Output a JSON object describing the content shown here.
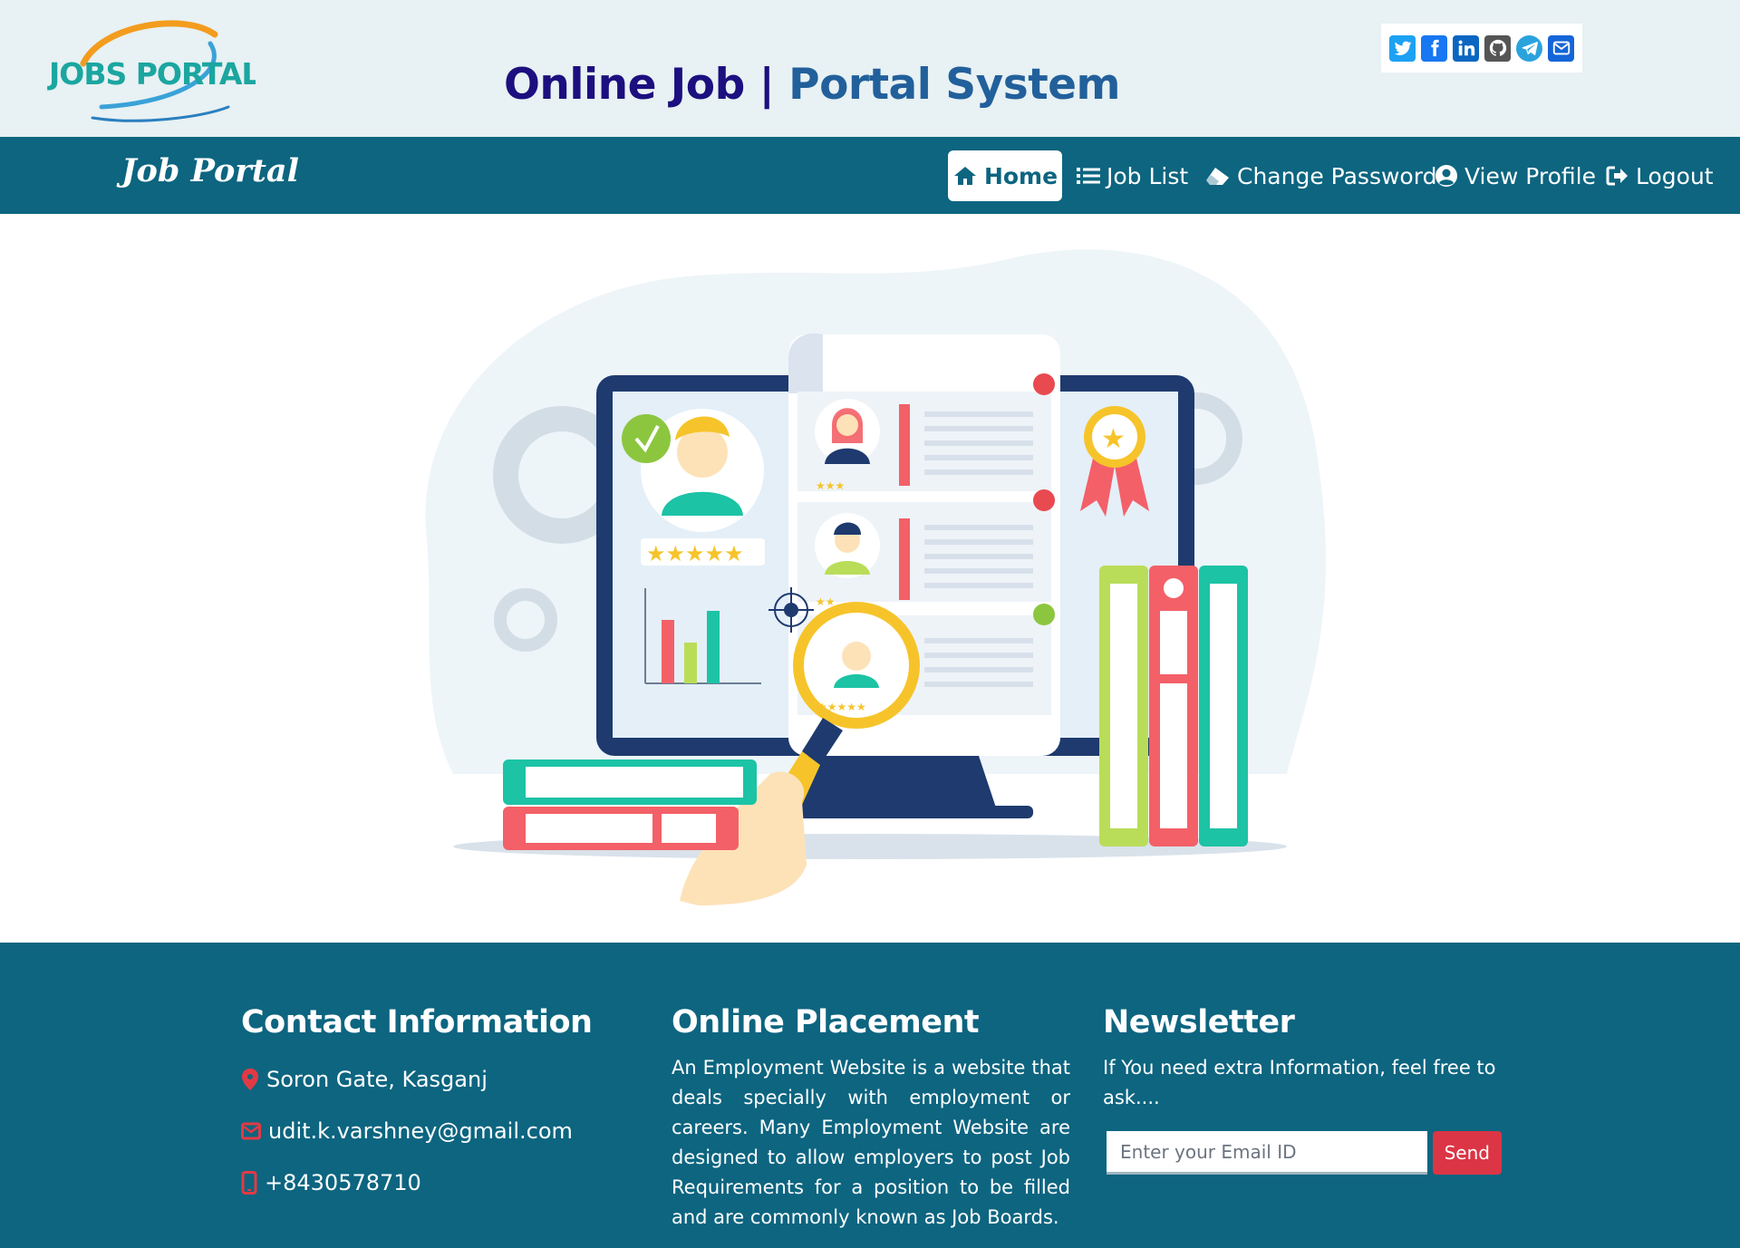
{
  "header": {
    "logo_text": "JOBS PORTAL",
    "title_part1": "Online Job",
    "title_separator": "|",
    "title_part2": "Portal System",
    "social_icons": [
      "twitter-icon",
      "facebook-icon",
      "linkedin-icon",
      "github-icon",
      "telegram-icon",
      "envelope-icon"
    ]
  },
  "navbar": {
    "brand": "Job Portal",
    "items": [
      {
        "label": "Home",
        "icon": "home-icon",
        "active": true
      },
      {
        "label": "Job List",
        "icon": "list-icon"
      },
      {
        "label": "Change Password",
        "icon": "eraser-icon"
      },
      {
        "label": "View Profile",
        "icon": "user-circle-icon"
      },
      {
        "label": "Logout",
        "icon": "sign-out-icon"
      }
    ]
  },
  "footer": {
    "contact": {
      "heading": "Contact Information",
      "address": "Soron Gate, Kasganj",
      "email": "udit.k.varshney@gmail.com",
      "phone": "+8430578710"
    },
    "placement": {
      "heading": "Online Placement",
      "text": "An Employment Website is a website that deals specially with employment or careers. Many Employment Website are designed to allow employers to post Job Requirements for a position to be filled and are commonly known as Job Boards."
    },
    "newsletter": {
      "heading": "Newsletter",
      "text": "If You need extra Information, feel free to ask....",
      "placeholder": "Enter your Email ID",
      "send_label": "Send"
    }
  },
  "colors": {
    "navbar": "#0d6580",
    "header_bg": "#e8f1f3",
    "title_dark": "#1c0f7f",
    "title_blue": "#22609b",
    "send_button": "#dc3545"
  }
}
